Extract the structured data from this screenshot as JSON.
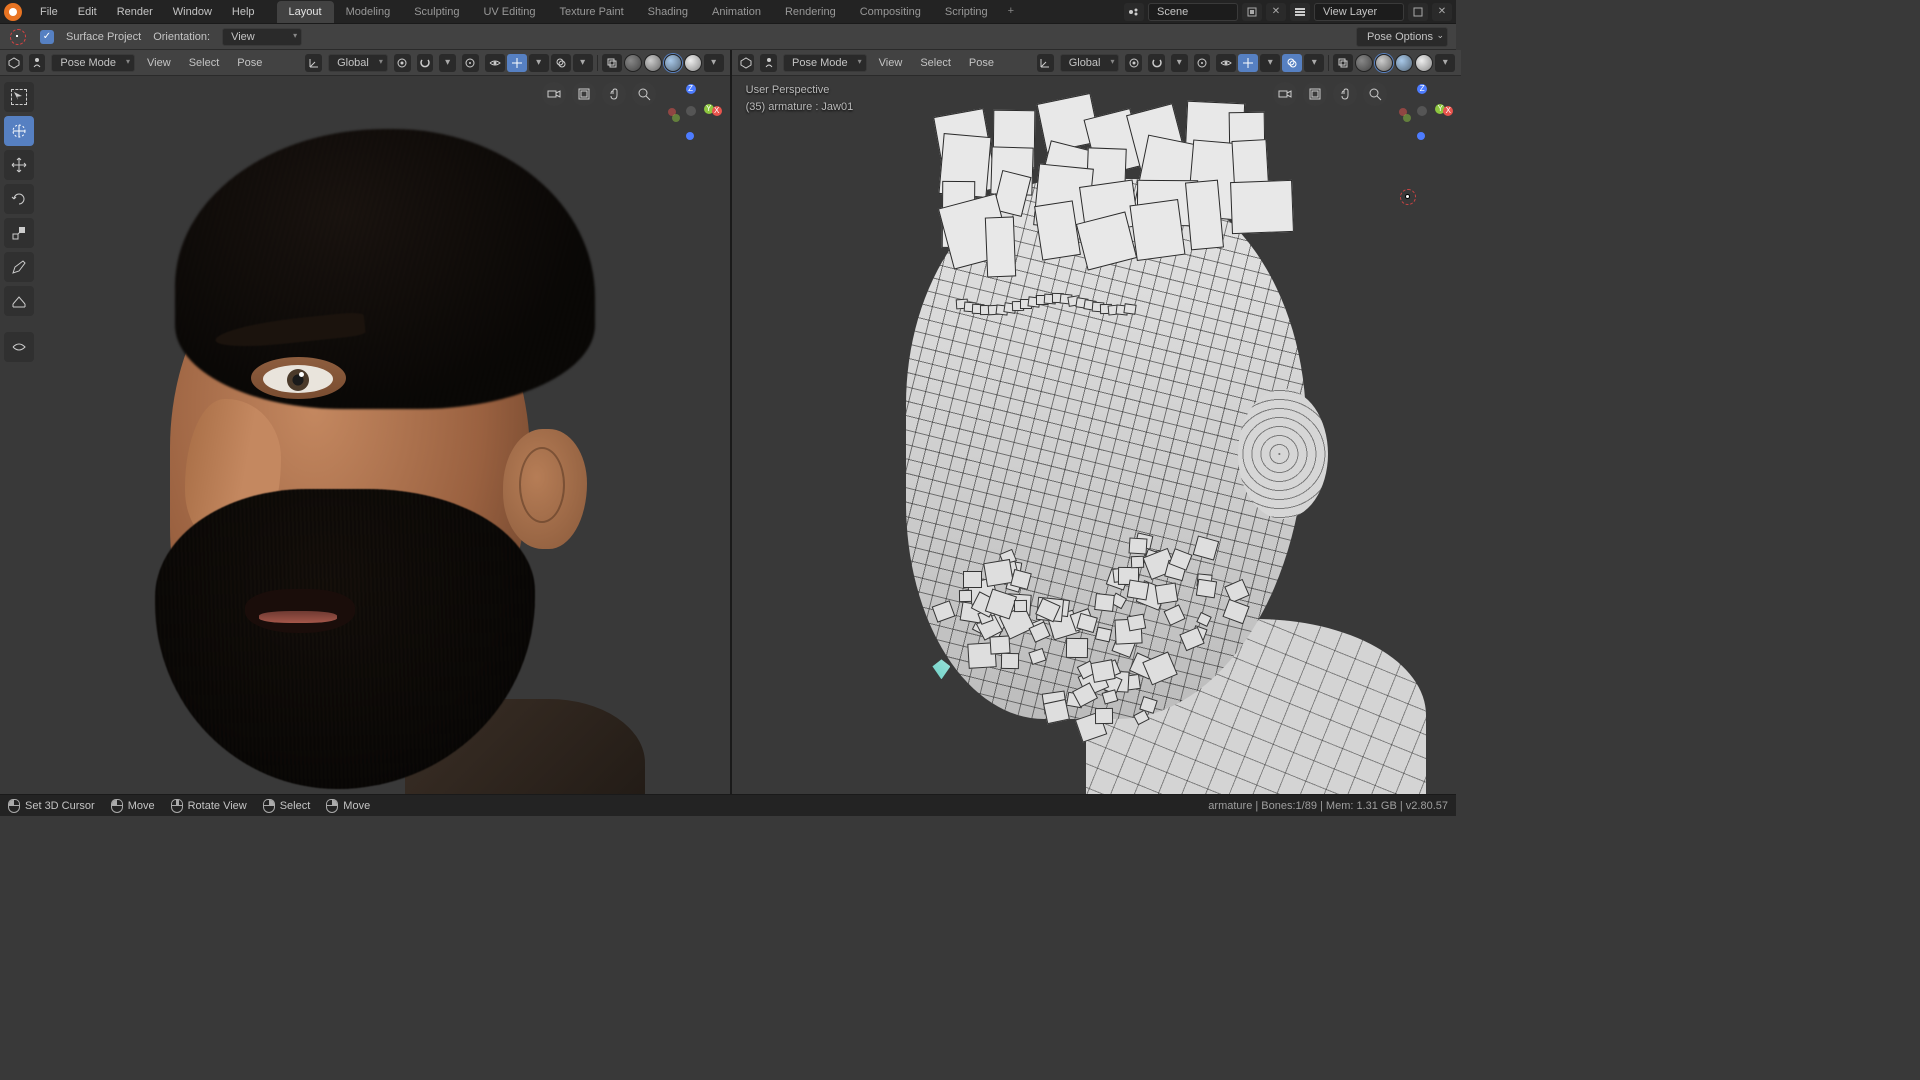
{
  "menubar": {
    "items": [
      "File",
      "Edit",
      "Render",
      "Window",
      "Help"
    ]
  },
  "workspaces": {
    "tabs": [
      "Layout",
      "Modeling",
      "Sculpting",
      "UV Editing",
      "Texture Paint",
      "Shading",
      "Animation",
      "Rendering",
      "Compositing",
      "Scripting"
    ],
    "active": "Layout",
    "plus": "+"
  },
  "header_right": {
    "scene_label": "Scene",
    "view_layer_label": "View Layer"
  },
  "toolbar": {
    "surface_project": "Surface Project",
    "orientation_label": "Orientation:",
    "orientation_value": "View",
    "pose_options": "Pose Options"
  },
  "viewport_header": {
    "mode": "Pose Mode",
    "menus": [
      "View",
      "Select",
      "Pose"
    ],
    "orientation": "Global"
  },
  "overlay": {
    "line1": "User Perspective",
    "line2": "(35) armature : Jaw01"
  },
  "axis": {
    "x": "X",
    "y": "Y",
    "z": "Z"
  },
  "status": {
    "cursor": "Set 3D Cursor",
    "move": "Move",
    "rotate": "Rotate View",
    "select": "Select",
    "move2": "Move",
    "right": "armature | Bones:1/89 | Mem: 1.31 GB | v2.80.57"
  }
}
